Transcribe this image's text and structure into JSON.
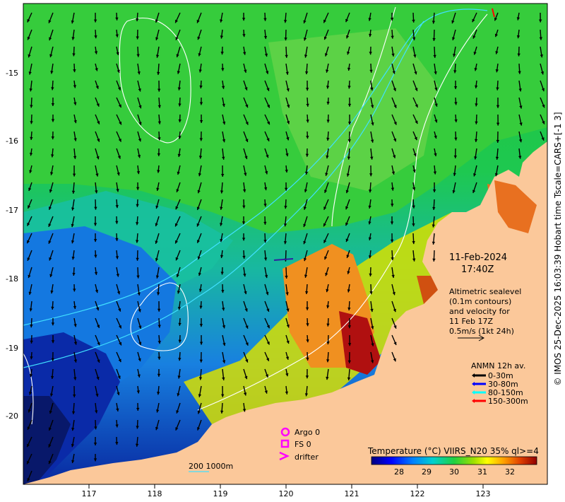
{
  "map": {
    "lon_ticks": [
      "117",
      "118",
      "119",
      "120",
      "121",
      "122",
      "123"
    ],
    "lat_ticks": [
      "-15",
      "-16",
      "-17",
      "-18",
      "-19",
      "-20"
    ],
    "date": "11-Feb-2024",
    "time": "17:40Z",
    "altimetry_note": [
      "Altimetric sealevel",
      "(0.1m contours)",
      "and velocity for",
      "11 Feb 17Z",
      "0.5m/s (1kt 24h)"
    ],
    "mooring_legend": {
      "title": "ANMN 12h av.",
      "items": [
        {
          "label": "0-30m",
          "color": "#000000"
        },
        {
          "label": "30-80m",
          "color": "#0000ff"
        },
        {
          "label": "80-150m",
          "color": "#00ffff"
        },
        {
          "label": "150-300m",
          "color": "#ff0000"
        }
      ]
    },
    "symbol_legend": {
      "argo": "Argo 0",
      "fs": "FS 0",
      "drifter": "drifter",
      "color": "#ff00ff"
    },
    "bathymetry_label": "200  1000m",
    "colorbar": {
      "title": "Temperature (°C) VIIRS_N20 35% ql>=4",
      "ticks": [
        "28",
        "29",
        "30",
        "31",
        "32"
      ],
      "colors": [
        "#000080",
        "#0000ff",
        "#0080ff",
        "#00c0ff",
        "#00e0a0",
        "#00d060",
        "#40d020",
        "#a0e000",
        "#ffff00",
        "#ffc000",
        "#ff8000",
        "#e04000",
        "#a00000"
      ]
    },
    "credit": "© IMOS 25-Dec-2025 16:03:39 Hobart time Tscale=CARS+[-1 3]",
    "colors": {
      "land": "#fbc89a",
      "contour": "#ffffff",
      "isobath": "#40e0ff"
    }
  }
}
